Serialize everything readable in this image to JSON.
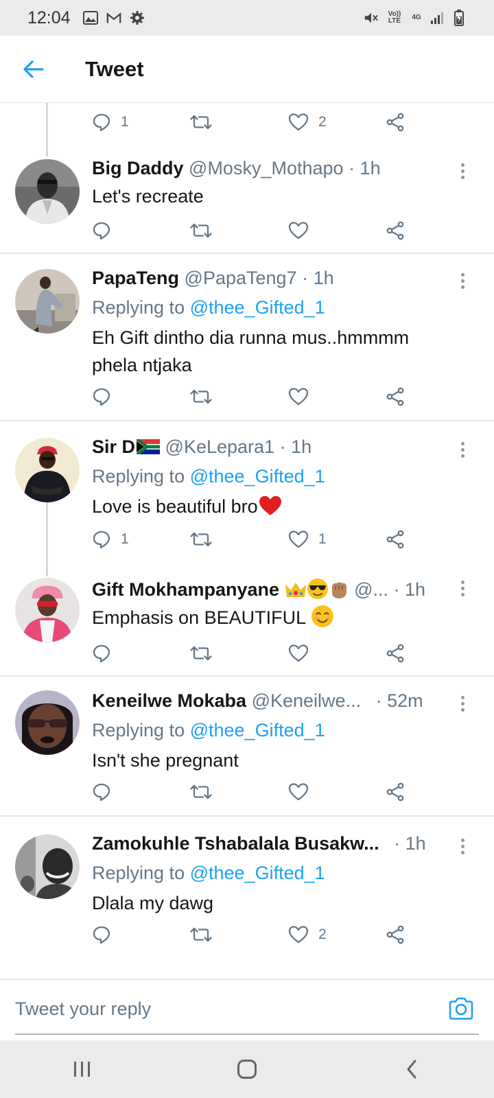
{
  "status_bar": {
    "time": "12:04",
    "signal_labels": [
      "Vo)) LTE",
      "4G"
    ]
  },
  "header": {
    "title": "Tweet"
  },
  "partial_tweet": {
    "reply_count": "1",
    "like_count": "2"
  },
  "tweets": [
    {
      "name": "Big Daddy",
      "handle": "@Mosky_Mothapo",
      "time": "· 1h",
      "reply_to_label": "",
      "reply_to_handle": "",
      "text": "Let's recreate",
      "reply_count": "",
      "retweet_count": "",
      "like_count": ""
    },
    {
      "name": "PapaTeng",
      "handle": "@PapaTeng7",
      "time": "· 1h",
      "reply_to_label": "Replying to ",
      "reply_to_handle": "@thee_Gifted_1",
      "text": "Eh Gift dintho dia runna mus..hmmmm phela ntjaka",
      "reply_count": "",
      "retweet_count": "",
      "like_count": ""
    },
    {
      "name": "Sir D",
      "handle": "@KeLepara1",
      "time": "· 1h",
      "reply_to_label": "Replying to ",
      "reply_to_handle": "@thee_Gifted_1",
      "text": "Love is beautiful bro",
      "reply_count": "1",
      "retweet_count": "",
      "like_count": "1"
    },
    {
      "name": "Gift Mokhampanyane",
      "handle": "@...",
      "time": "· 1h",
      "reply_to_label": "",
      "reply_to_handle": "",
      "text": "Emphasis on BEAUTIFUL",
      "reply_count": "",
      "retweet_count": "",
      "like_count": ""
    },
    {
      "name": "Keneilwe Mokaba",
      "handle": "@Keneilwe...",
      "time": "· 52m",
      "reply_to_label": "Replying to ",
      "reply_to_handle": "@thee_Gifted_1",
      "text": "Isn't she pregnant",
      "reply_count": "",
      "retweet_count": "",
      "like_count": ""
    },
    {
      "name": "Zamokuhle Tshabalala Busakw...",
      "handle": "",
      "time": "· 1h",
      "reply_to_label": "Replying to ",
      "reply_to_handle": "@thee_Gifted_1",
      "text": "Dlala my dawg",
      "reply_count": "",
      "retweet_count": "",
      "like_count": "2"
    }
  ],
  "reply_box": {
    "placeholder": "Tweet your reply"
  },
  "colors": {
    "accent": "#1da1f2",
    "secondary_text": "#657786",
    "divider": "#e1e8ed",
    "heart_red": "#e0245e"
  },
  "icons": [
    "back-arrow-icon",
    "reply-icon",
    "retweet-icon",
    "like-icon",
    "share-icon",
    "more-icon",
    "camera-icon",
    "recents-icon",
    "home-icon",
    "nav-back-icon"
  ]
}
